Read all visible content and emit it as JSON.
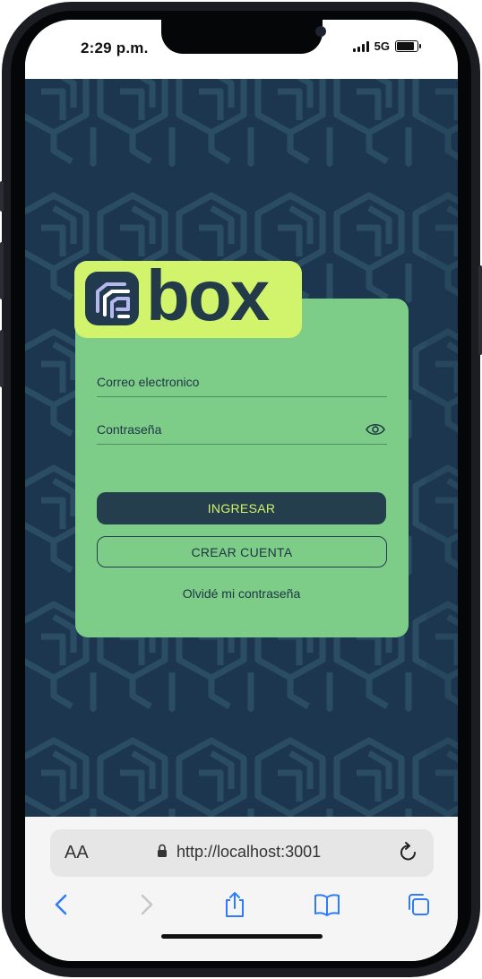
{
  "status": {
    "time": "2:29 p.m.",
    "network": "5G"
  },
  "logo": {
    "text": "box"
  },
  "form": {
    "email_label": "Correo electronico",
    "password_label": "Contraseña",
    "login_button": "INGRESAR",
    "register_button": "CREAR CUENTA",
    "forgot_link": "Olvidé mi contraseña"
  },
  "browser": {
    "text_size_label": "AA",
    "url": "http://localhost:3001"
  },
  "colors": {
    "background": "#1d3650",
    "card": "#7dcd88",
    "logo_bg": "#d2f36c",
    "primary_button": "#243e4d"
  },
  "icons": [
    "show-password-icon",
    "lock-icon",
    "reload-icon",
    "back-icon",
    "forward-icon",
    "share-icon",
    "bookmarks-icon",
    "tabs-icon"
  ]
}
